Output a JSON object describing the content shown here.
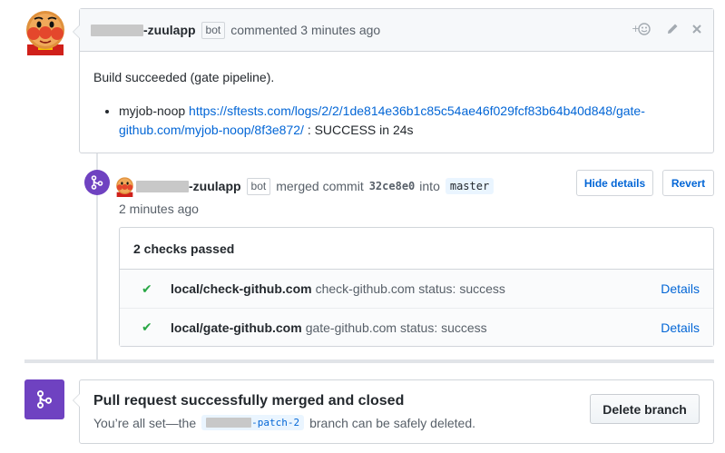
{
  "comment": {
    "author_suffix": "-zuulapp",
    "bot_label": "bot",
    "action": "commented 3 minutes ago",
    "body_title": "Build succeeded (gate pipeline).",
    "job_name": "myjob-noop",
    "job_link": "https://sftests.com/logs/2/2/1de814e36b1c85c54ae46f029fcf83b64b40d848/gate-github.com/myjob-noop/8f3e872/",
    "job_link_line1": "https://sftests.com/logs/2/2/1de814e36b1c85c54ae46f029fcf83b64b40d848/gate-",
    "job_link_line2": "github.com/myjob-noop/8f3e872/",
    "job_result": ": SUCCESS in 24s"
  },
  "merge_event": {
    "author_suffix": "-zuulapp",
    "bot_label": "bot",
    "action": "merged commit",
    "commit_sha": "32ce8e0",
    "into": "into",
    "branch": "master",
    "time": "2 minutes ago",
    "hide_details_label": "Hide details",
    "revert_label": "Revert"
  },
  "checks": {
    "summary": "2 checks passed",
    "items": [
      {
        "name": "local/check-github.com",
        "description": "check-github.com status: success",
        "details_label": "Details",
        "status": "success"
      },
      {
        "name": "local/gate-github.com",
        "description": "gate-github.com status: success",
        "details_label": "Details",
        "status": "success"
      }
    ]
  },
  "merged_status": {
    "title": "Pull request successfully merged and closed",
    "subtitle_prefix": "You’re all set—the",
    "branch_suffix": "-patch-2",
    "subtitle_suffix": "branch can be safely deleted.",
    "delete_label": "Delete branch"
  },
  "colors": {
    "merged_purple": "#6f42c1",
    "link_blue": "#0366d6",
    "success_green": "#28a745"
  }
}
